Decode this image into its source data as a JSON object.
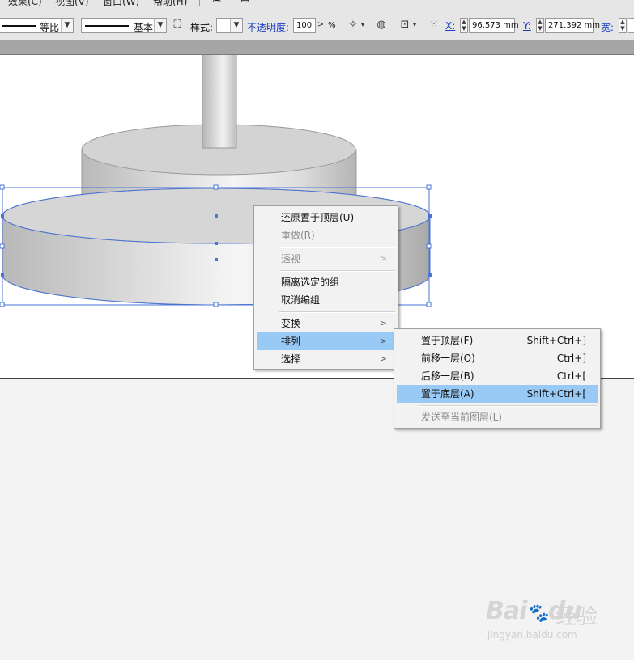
{
  "menubar": {
    "items": [
      "效果(C)",
      "视图(V)",
      "窗口(W)",
      "帮助(H)"
    ]
  },
  "control_bar": {
    "profile_select": "等比",
    "brush_select": "基本",
    "style_label": "样式:",
    "opacity_label": "不透明度:",
    "opacity_value": "100",
    "opacity_unit": "%",
    "x_label": "X:",
    "x_value": "96.573 mm",
    "y_label": "Y:",
    "y_value": "271.392 mm",
    "width_label": "宽:",
    "icons": [
      "fit-stroke-icon",
      "recolor-icon",
      "global-edit-icon",
      "align-icon",
      "transform-grid-icon",
      "reference-point-icon"
    ]
  },
  "context_menu": {
    "items": [
      {
        "label": "还原置于顶层(U)",
        "disabled": false,
        "submenu": false
      },
      {
        "label": "重做(R)",
        "disabled": true,
        "submenu": false
      },
      {
        "label": "透视",
        "disabled": true,
        "submenu": true
      },
      {
        "label": "隔离选定的组",
        "disabled": false,
        "submenu": false
      },
      {
        "label": "取消编组",
        "disabled": false,
        "submenu": false
      },
      {
        "label": "变换",
        "disabled": false,
        "submenu": true
      },
      {
        "label": "排列",
        "disabled": false,
        "submenu": true,
        "highlighted": true
      },
      {
        "label": "选择",
        "disabled": false,
        "submenu": true
      }
    ]
  },
  "arrange_submenu": {
    "items": [
      {
        "label": "置于顶层(F)",
        "shortcut": "Shift+Ctrl+]"
      },
      {
        "label": "前移一层(O)",
        "shortcut": "Ctrl+]"
      },
      {
        "label": "后移一层(B)",
        "shortcut": "Ctrl+["
      },
      {
        "label": "置于底层(A)",
        "shortcut": "Shift+Ctrl+[",
        "highlighted": true
      },
      {
        "label": "发送至当前图层(L)",
        "shortcut": "",
        "disabled": true
      }
    ]
  },
  "colors": {
    "highlight": "#99c9f5",
    "selection": "#4a73d8"
  },
  "watermark": {
    "brand": "Bai",
    "brand2": "du",
    "cn": "经验",
    "url": "jingyan.baidu.com"
  }
}
